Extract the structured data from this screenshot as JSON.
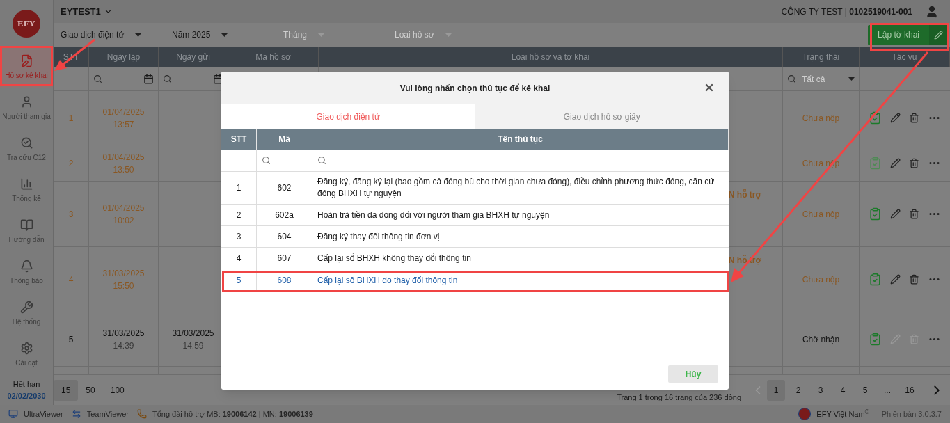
{
  "top_bar": {
    "account": "EYTEST1",
    "company": "CÔNG TY TEST | **0102519041-001**"
  },
  "sidebar": {
    "logo": "EFY",
    "items": [
      {
        "label": "Hồ sơ kê khai",
        "kind": "file-edit",
        "selected": true
      },
      {
        "label": "Người tham gia",
        "kind": "user",
        "selected": false
      },
      {
        "label": "Tra cứu C12",
        "kind": "lookup",
        "selected": false
      },
      {
        "label": "Thống kê",
        "kind": "chart",
        "selected": false
      },
      {
        "label": "Hướng dẫn",
        "kind": "guide",
        "selected": false
      },
      {
        "label": "Thông báo",
        "kind": "bell",
        "selected": false
      },
      {
        "label": "Hệ thống",
        "kind": "tools",
        "selected": false
      },
      {
        "label": "Cài đặt",
        "kind": "gear",
        "selected": false
      }
    ],
    "expiry_label": "Hết hạn",
    "expiry_date": "02/02/2030"
  },
  "filters": [
    {
      "label": "Giao dịch điện tử",
      "disabled": false
    },
    {
      "label": "Năm 2025",
      "disabled": false
    },
    {
      "label": "Tháng",
      "disabled": true
    },
    {
      "label": "Loại hồ sơ",
      "disabled": true
    }
  ],
  "create_button": {
    "label": "Lập tờ khai"
  },
  "table": {
    "columns": [
      "STT",
      "Ngày lập",
      "Ngày gửi",
      "Mã hồ sơ",
      "Loại hồ sơ và tờ khai",
      "Trạng thái",
      "Tác vụ"
    ],
    "status_filter": "Tất cả",
    "rows": [
      {
        "stt": "1",
        "created_date": "01/04/2025",
        "created_time": "13:57",
        "status": "Chưa nộp",
        "sent": false,
        "approve_disabled": false,
        "edit_disabled": false,
        "delete_disabled": false
      },
      {
        "stt": "2",
        "created_date": "01/04/2025",
        "created_time": "13:50",
        "status": "Chưa nộp",
        "sent": false,
        "approve_disabled": true,
        "edit_disabled": false,
        "delete_disabled": false
      },
      {
        "stt": "3",
        "created_date": "01/04/2025",
        "created_time": "10:02",
        "type": "N hỗ trợ",
        "status": "Chưa nộp",
        "sent": false,
        "approve_disabled": false,
        "edit_disabled": false,
        "delete_disabled": false
      },
      {
        "stt": "4",
        "created_date": "31/03/2025",
        "created_time": "15:50",
        "type": "N hỗ trợ",
        "status": "Chưa nộp",
        "sent": false,
        "approve_disabled": false,
        "edit_disabled": false,
        "delete_disabled": false
      },
      {
        "stt": "5",
        "created_date": "31/03/2025",
        "created_time": "14:39",
        "sent_date": "31/03/2025",
        "sent_time": "14:59",
        "status": "Chờ nhận",
        "sent": true,
        "approve_disabled": false,
        "edit_disabled": true,
        "delete_disabled": true
      }
    ]
  },
  "pagination": {
    "page_sizes": [
      {
        "label": "15",
        "selected": true
      },
      {
        "label": "50",
        "selected": false
      },
      {
        "label": "100",
        "selected": false
      }
    ],
    "summary": "Trang 1 trong 16 trang của 236 dòng",
    "prev_disabled": true,
    "pages": [
      {
        "label": "1",
        "selected": true
      },
      {
        "label": "2",
        "selected": false
      },
      {
        "label": "3",
        "selected": false
      },
      {
        "label": "4",
        "selected": false
      },
      {
        "label": "5",
        "selected": false
      },
      {
        "label": "...",
        "selected": false
      },
      {
        "label": "16",
        "selected": false
      }
    ]
  },
  "modal": {
    "title": "Vui lòng nhấn chọn thủ tục để kê khai",
    "tabs": [
      {
        "label": "Giao dịch điện tử",
        "selected": true
      },
      {
        "label": "Giao dịch hồ sơ giấy",
        "selected": false
      }
    ],
    "columns": [
      "STT",
      "Mã",
      "Tên thủ tục"
    ],
    "rows": [
      {
        "stt": "1",
        "code": "602",
        "name": "Đăng ký, đăng ký lại (bao gồm cả đóng bù cho thời gian chưa đóng), điều chỉnh phương thức đóng, căn cứ đóng BHXH tự nguyện",
        "selected": false
      },
      {
        "stt": "2",
        "code": "602a",
        "name": "Hoàn trả tiền đã đóng đối với người tham gia BHXH tự nguyện",
        "selected": false
      },
      {
        "stt": "3",
        "code": "604",
        "name": "Đăng ký thay đổi thông tin đơn vị",
        "selected": false
      },
      {
        "stt": "4",
        "code": "607",
        "name": "Cấp lại sổ BHXH không thay đổi thông tin",
        "selected": false
      },
      {
        "stt": "5",
        "code": "608",
        "name": "Cấp lại sổ BHXH do thay đổi thông tin",
        "selected": true
      }
    ],
    "cancel": "Hủy"
  },
  "status_bar": {
    "items": [
      {
        "kind": "ultraviewer",
        "label": "UltraViewer"
      },
      {
        "kind": "teamviewer",
        "label": "TeamViewer"
      },
      {
        "kind": "phone",
        "label": "Tổng đài hỗ trợ MB: **19006142** | MN: **19006139**"
      }
    ],
    "brand": "EFY Việt Nam$^{©}$",
    "version": "Phiên bản 3.0.3.7"
  }
}
